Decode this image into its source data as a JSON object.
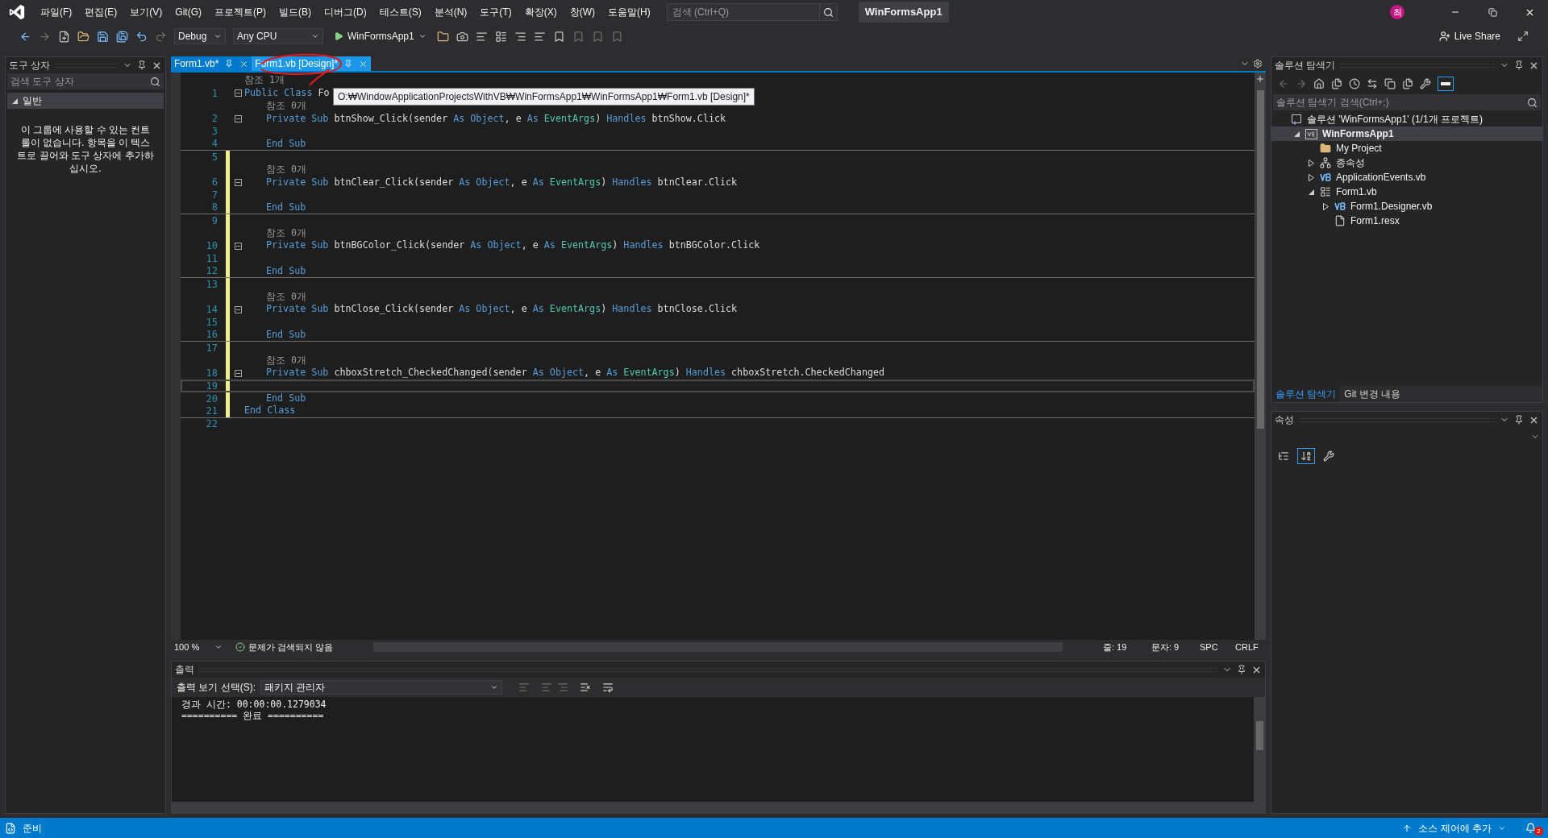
{
  "title_bar": {
    "menu": [
      "파일(F)",
      "편집(E)",
      "보기(V)",
      "Git(G)",
      "프로젝트(P)",
      "빌드(B)",
      "디버그(D)",
      "테스트(S)",
      "분석(N)",
      "도구(T)",
      "확장(X)",
      "창(W)",
      "도움말(H)"
    ],
    "search": {
      "placeholder": "검색 (Ctrl+Q)"
    },
    "title": "WinFormsApp1",
    "avatar": "최"
  },
  "toolbar": {
    "configuration": "Debug",
    "platform": "Any CPU",
    "start": "WinFormsApp1",
    "live_share": "Live Share"
  },
  "toolbox": {
    "title": "도구 상자",
    "search": {
      "placeholder": "검색 도구 상자"
    },
    "group": {
      "label": "일반",
      "expanded": true
    },
    "message": "이 그룹에 사용할 수 있는 컨트롤이 없습니다. 항목을 이 텍스트로 끌어와 도구 상자에 추가하십시오."
  },
  "editor": {
    "tabs": [
      {
        "label": "Form1.vb*",
        "selected": true
      },
      {
        "label": "Form1.vb [Design]*",
        "selected": false
      }
    ],
    "tooltip": "O:₩WindowApplicationProjectsWithVB₩WinFormsApp1₩WinFormsApp1₩Form1.vb [Design]*",
    "rows": [
      {
        "kind": "lens",
        "text": "참조 1개",
        "indented": false,
        "modified": false
      },
      {
        "kind": "code",
        "number": "1",
        "indented": false,
        "modified": false,
        "collapsible": true,
        "current": false,
        "separator_below": false,
        "tokens": [
          {
            "kind": "kw",
            "text": "Public Class"
          },
          {
            "kind": "text",
            "text": " Fo"
          }
        ]
      },
      {
        "kind": "lens",
        "text": "참조 0개",
        "indented": true,
        "modified": false
      },
      {
        "kind": "code",
        "number": "2",
        "indented": true,
        "modified": false,
        "collapsible": true,
        "current": false,
        "separator_below": false,
        "tokens": [
          {
            "kind": "kw",
            "text": "Private Sub"
          },
          {
            "kind": "text",
            "text": " btnShow_Click(sender "
          },
          {
            "kind": "kw",
            "text": "As Object"
          },
          {
            "kind": "text",
            "text": ", e "
          },
          {
            "kind": "kw",
            "text": "As"
          },
          {
            "kind": "type",
            "text": " EventArgs"
          },
          {
            "kind": "text",
            "text": ") "
          },
          {
            "kind": "kw",
            "text": "Handles"
          },
          {
            "kind": "text",
            "text": " btnShow.Click"
          }
        ]
      },
      {
        "kind": "code",
        "number": "3",
        "modified": false,
        "collapsible": false,
        "current": false,
        "separator_below": false,
        "tokens": []
      },
      {
        "kind": "code",
        "number": "4",
        "indented": true,
        "modified": false,
        "collapsible": false,
        "current": false,
        "separator_below": true,
        "tokens": [
          {
            "kind": "kw",
            "text": "End Sub"
          }
        ]
      },
      {
        "kind": "code",
        "number": "5",
        "modified": true,
        "collapsible": false,
        "current": false,
        "separator_below": false,
        "tokens": []
      },
      {
        "kind": "lens",
        "text": "참조 0개",
        "indented": true,
        "modified": true
      },
      {
        "kind": "code",
        "number": "6",
        "indented": true,
        "modified": true,
        "collapsible": true,
        "current": false,
        "separator_below": false,
        "tokens": [
          {
            "kind": "kw",
            "text": "Private Sub"
          },
          {
            "kind": "text",
            "text": " btnClear_Click(sender "
          },
          {
            "kind": "kw",
            "text": "As Object"
          },
          {
            "kind": "text",
            "text": ", e "
          },
          {
            "kind": "kw",
            "text": "As"
          },
          {
            "kind": "type",
            "text": " EventArgs"
          },
          {
            "kind": "text",
            "text": ") "
          },
          {
            "kind": "kw",
            "text": "Handles"
          },
          {
            "kind": "text",
            "text": " btnClear.Click"
          }
        ]
      },
      {
        "kind": "code",
        "number": "7",
        "modified": true,
        "collapsible": false,
        "current": false,
        "separator_below": false,
        "tokens": []
      },
      {
        "kind": "code",
        "number": "8",
        "indented": true,
        "modified": true,
        "collapsible": false,
        "current": false,
        "separator_below": true,
        "tokens": [
          {
            "kind": "kw",
            "text": "End Sub"
          }
        ]
      },
      {
        "kind": "code",
        "number": "9",
        "modified": true,
        "collapsible": false,
        "current": false,
        "separator_below": false,
        "tokens": []
      },
      {
        "kind": "lens",
        "text": "참조 0개",
        "indented": true,
        "modified": true
      },
      {
        "kind": "code",
        "number": "10",
        "indented": true,
        "modified": true,
        "collapsible": true,
        "current": false,
        "separator_below": false,
        "tokens": [
          {
            "kind": "kw",
            "text": "Private Sub"
          },
          {
            "kind": "text",
            "text": " btnBGColor_Click(sender "
          },
          {
            "kind": "kw",
            "text": "As Object"
          },
          {
            "kind": "text",
            "text": ", e "
          },
          {
            "kind": "kw",
            "text": "As"
          },
          {
            "kind": "type",
            "text": " EventArgs"
          },
          {
            "kind": "text",
            "text": ") "
          },
          {
            "kind": "kw",
            "text": "Handles"
          },
          {
            "kind": "text",
            "text": " btnBGColor.Click"
          }
        ]
      },
      {
        "kind": "code",
        "number": "11",
        "modified": true,
        "collapsible": false,
        "current": false,
        "separator_below": false,
        "tokens": []
      },
      {
        "kind": "code",
        "number": "12",
        "indented": true,
        "modified": true,
        "collapsible": false,
        "current": false,
        "separator_below": true,
        "tokens": [
          {
            "kind": "kw",
            "text": "End Sub"
          }
        ]
      },
      {
        "kind": "code",
        "number": "13",
        "modified": true,
        "collapsible": false,
        "current": false,
        "separator_below": false,
        "tokens": []
      },
      {
        "kind": "lens",
        "text": "참조 0개",
        "indented": true,
        "modified": true
      },
      {
        "kind": "code",
        "number": "14",
        "indented": true,
        "modified": true,
        "collapsible": true,
        "current": false,
        "separator_below": false,
        "tokens": [
          {
            "kind": "kw",
            "text": "Private Sub"
          },
          {
            "kind": "text",
            "text": " btnClose_Click(sender "
          },
          {
            "kind": "kw",
            "text": "As Object"
          },
          {
            "kind": "text",
            "text": ", e "
          },
          {
            "kind": "kw",
            "text": "As"
          },
          {
            "kind": "type",
            "text": " EventArgs"
          },
          {
            "kind": "text",
            "text": ") "
          },
          {
            "kind": "kw",
            "text": "Handles"
          },
          {
            "kind": "text",
            "text": " btnClose.Click"
          }
        ]
      },
      {
        "kind": "code",
        "number": "15",
        "modified": true,
        "collapsible": false,
        "current": false,
        "separator_below": false,
        "tokens": []
      },
      {
        "kind": "code",
        "number": "16",
        "indented": true,
        "modified": true,
        "collapsible": false,
        "current": false,
        "separator_below": true,
        "tokens": [
          {
            "kind": "kw",
            "text": "End Sub"
          }
        ]
      },
      {
        "kind": "code",
        "number": "17",
        "modified": true,
        "collapsible": false,
        "current": false,
        "separator_below": false,
        "tokens": []
      },
      {
        "kind": "lens",
        "text": "참조 0개",
        "indented": true,
        "modified": true
      },
      {
        "kind": "code",
        "number": "18",
        "indented": true,
        "modified": true,
        "collapsible": true,
        "current": false,
        "separator_below": false,
        "tokens": [
          {
            "kind": "kw",
            "text": "Private Sub"
          },
          {
            "kind": "text",
            "text": " chboxStretch_CheckedChanged(sender "
          },
          {
            "kind": "kw",
            "text": "As Object"
          },
          {
            "kind": "text",
            "text": ", e "
          },
          {
            "kind": "kw",
            "text": "As"
          },
          {
            "kind": "type",
            "text": " EventArgs"
          },
          {
            "kind": "text",
            "text": ") "
          },
          {
            "kind": "kw",
            "text": "Handles"
          },
          {
            "kind": "text",
            "text": " chboxStretch.CheckedChanged"
          }
        ]
      },
      {
        "kind": "code",
        "number": "19",
        "modified": true,
        "collapsible": false,
        "current": true,
        "separator_below": false,
        "tokens": []
      },
      {
        "kind": "code",
        "number": "20",
        "indented": true,
        "modified": true,
        "collapsible": false,
        "current": false,
        "separator_below": false,
        "tokens": [
          {
            "kind": "kw",
            "text": "End Sub"
          }
        ]
      },
      {
        "kind": "code",
        "number": "21",
        "indented": false,
        "modified": true,
        "collapsible": false,
        "current": false,
        "separator_below": true,
        "tokens": [
          {
            "kind": "kw",
            "text": "End Class"
          }
        ]
      },
      {
        "kind": "code",
        "number": "22",
        "modified": false,
        "collapsible": false,
        "current": false,
        "separator_below": false,
        "tokens": []
      }
    ],
    "status": {
      "zoom": "100 %",
      "issues": "문제가 검색되지 않음",
      "line": "줄: 19",
      "column": "문자: 9",
      "whitespace": "SPC",
      "line_ending": "CRLF"
    }
  },
  "output": {
    "title": "출력",
    "source_label": "출력 보기 선택(S):",
    "source": "패키지 관리자",
    "lines": [
      "경과 시간: 00:00:00.1279034",
      "========== 완료 =========="
    ]
  },
  "solution_explorer": {
    "title": "솔루션 탐색기",
    "preview_selected": {
      "on": true
    },
    "search": {
      "placeholder": "솔루션 탐색기 검색(Ctrl+;)"
    },
    "tree": [
      {
        "kind": "solution",
        "label": "솔루션 'WinFormsApp1' (1/1개 프로젝트)",
        "selected": false,
        "children": [
          {
            "kind": "project",
            "label": "WinFormsApp1",
            "selected": true,
            "expanded": true,
            "children": [
              {
                "kind": "myproject",
                "label": "My Project",
                "selected": false
              },
              {
                "kind": "deps",
                "label": "종속성",
                "selected": false,
                "expanded": false
              },
              {
                "kind": "vb",
                "label": "ApplicationEvents.vb",
                "selected": false,
                "expanded": false
              },
              {
                "kind": "form",
                "label": "Form1.vb",
                "selected": false,
                "expanded": true,
                "children": [
                  {
                    "kind": "vb",
                    "label": "Form1.Designer.vb",
                    "selected": false,
                    "expanded": false
                  },
                  {
                    "kind": "resx",
                    "label": "Form1.resx",
                    "selected": false
                  }
                ]
              }
            ]
          }
        ]
      }
    ],
    "tabs": [
      {
        "label": "솔루션 탐색기",
        "selected": true
      },
      {
        "label": "Git 변경 내용",
        "selected": false
      }
    ]
  },
  "properties": {
    "title": "속성",
    "view_buttons": [
      {
        "kind": "categorized",
        "selected": false
      },
      {
        "kind": "alphabetical",
        "selected": true
      },
      {
        "kind": "pages",
        "selected": false
      }
    ]
  },
  "status_bar": {
    "text": "준비",
    "source_control": "소스 제어에 추가",
    "notifications": "2"
  }
}
